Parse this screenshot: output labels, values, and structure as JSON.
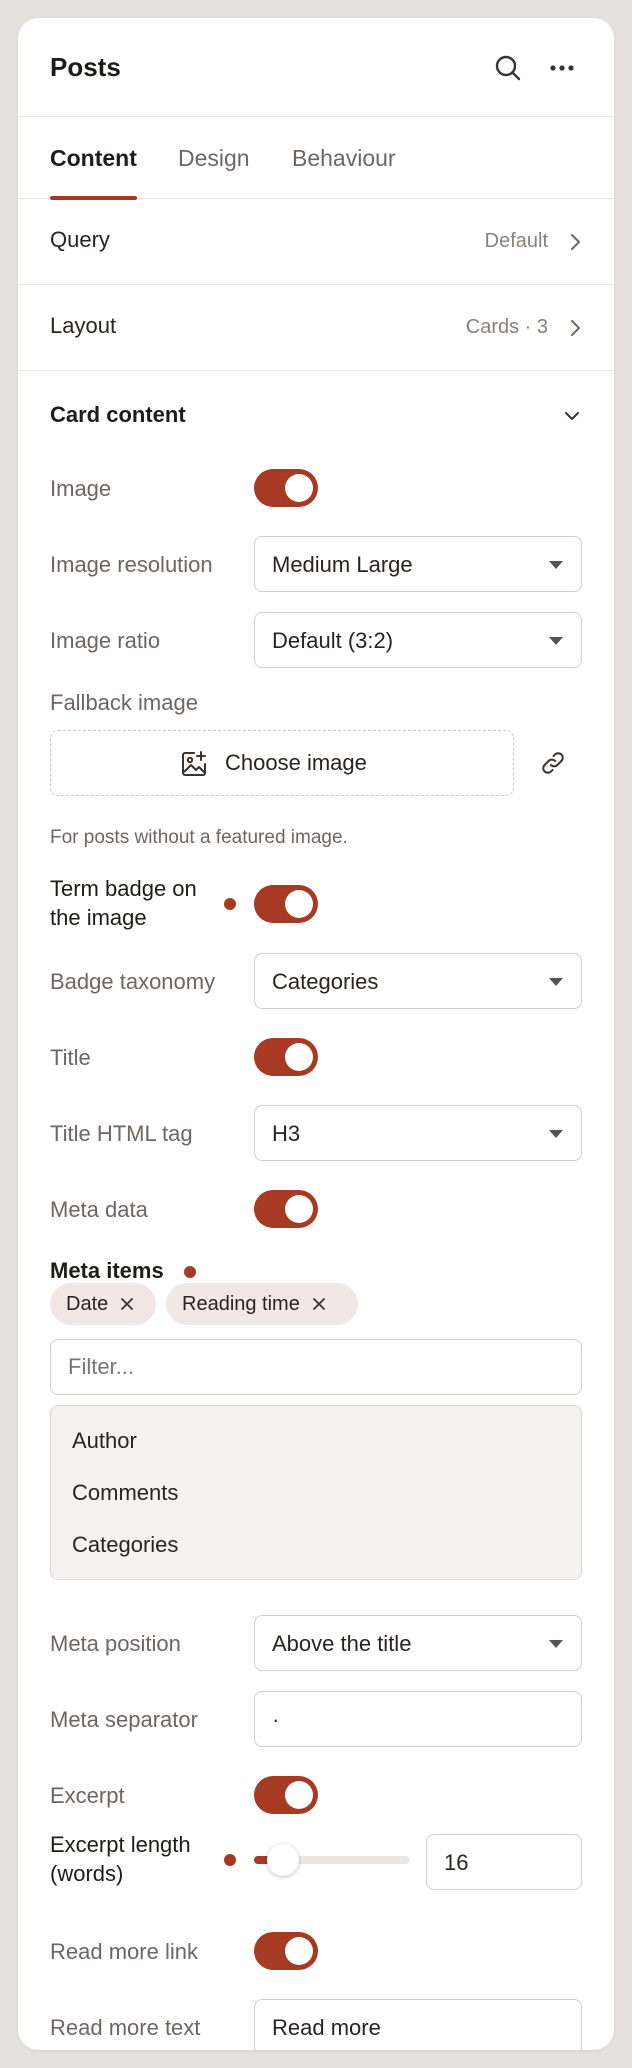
{
  "header": {
    "title": "Posts",
    "search_icon": "search-icon",
    "more_icon": "more-horizontal-icon"
  },
  "tabs": [
    {
      "label": "Content",
      "active": true
    },
    {
      "label": "Design",
      "active": false
    },
    {
      "label": "Behaviour",
      "active": false
    }
  ],
  "rows": [
    {
      "label": "Query",
      "value": "Default"
    },
    {
      "label": "Layout",
      "value": "Cards · 3"
    }
  ],
  "card_content": {
    "title": "Card content",
    "image_label": "Image",
    "image_toggle": true,
    "image_resolution_label": "Image resolution",
    "image_resolution_value": "Medium Large",
    "image_ratio_label": "Image ratio",
    "image_ratio_value": "Default (3:2)",
    "fallback_label": "Fallback image",
    "choose_image_label": "Choose image",
    "fallback_help": "For posts without a featured image.",
    "term_badge_label": "Term badge on the image",
    "term_badge_toggle": true,
    "badge_taxonomy_label": "Badge taxonomy",
    "badge_taxonomy_value": "Categories",
    "title_label": "Title",
    "title_toggle": true,
    "title_tag_label": "Title HTML tag",
    "title_tag_value": "H3",
    "meta_data_label": "Meta data",
    "meta_data_toggle": true,
    "meta_items_label": "Meta items",
    "meta_items_selected": [
      "Date",
      "Reading time"
    ],
    "filter_placeholder": "Filter...",
    "meta_items_options": [
      "Author",
      "Comments",
      "Categories"
    ],
    "meta_position_label": "Meta position",
    "meta_position_value": "Above the title",
    "meta_separator_label": "Meta separator",
    "meta_separator_value": "·",
    "excerpt_label": "Excerpt",
    "excerpt_toggle": true,
    "excerpt_length_label": "Excerpt length (words)",
    "excerpt_length_value": "16",
    "read_more_link_label": "Read more link",
    "read_more_link_toggle": true,
    "read_more_text_label": "Read more text",
    "read_more_text_value": "Read more"
  },
  "colors": {
    "accent": "#a63a22",
    "chip_bg": "#f0e8e5",
    "list_bg": "#f6f2ef"
  }
}
